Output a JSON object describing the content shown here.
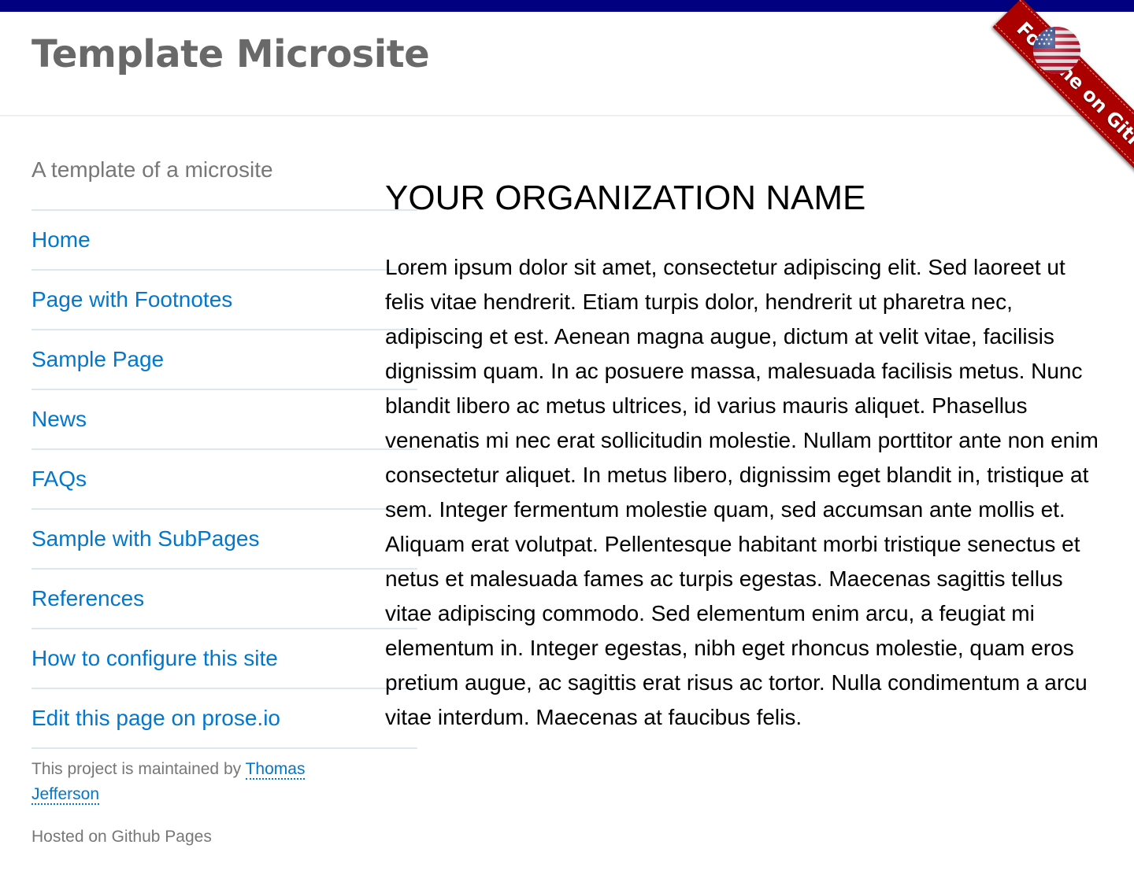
{
  "header": {
    "title": "Template Microsite",
    "ribbon_label": "Fork me on GitHub",
    "flag_icon": "us-flag-icon"
  },
  "sidebar": {
    "tagline": "A template of a microsite",
    "nav": [
      {
        "label": "Home"
      },
      {
        "label": "Page with Footnotes"
      },
      {
        "label": "Sample Page"
      },
      {
        "label": "News"
      },
      {
        "label": "FAQs"
      },
      {
        "label": "Sample with SubPages"
      },
      {
        "label": "References"
      },
      {
        "label": "How to configure this site"
      },
      {
        "label": "Edit this page on prose.io"
      }
    ],
    "maintainer_prefix": "This project is maintained by",
    "maintainer_name": "Thomas Jefferson",
    "hosted_text": "Hosted on Github Pages"
  },
  "main": {
    "heading": "YOUR ORGANIZATION NAME",
    "paragraph": "Lorem ipsum dolor sit amet, consectetur adipiscing elit. Sed laoreet ut felis vitae hendrerit. Etiam turpis dolor, hendrerit ut pharetra nec, adipiscing et est. Aenean magna augue, dictum at velit vitae, facilisis dignissim quam. In ac posuere massa, malesuada facilisis metus. Nunc blandit libero ac metus ultrices, id varius mauris aliquet. Phasellus venenatis mi nec erat sollicitudin molestie. Nullam porttitor ante non enim consectetur aliquet. In metus libero, dignissim eget blandit in, tristique at sem. Integer fermentum molestie quam, sed accumsan ante mollis et. Aliquam erat volutpat. Pellentesque habitant morbi tristique senectus et netus et malesuada fames ac turpis egestas. Maecenas sagittis tellus vitae adipiscing commodo. Sed elementum enim arcu, a feugiat mi elementum in. Integer egestas, nibh eget rhoncus molestie, quam eros pretium augue, ac sagittis erat risus ac tortor. Nulla condimentum a arcu vitae interdum. Maecenas at faucibus felis."
  },
  "colors": {
    "top_bar": "#000080",
    "link": "#0277cc",
    "ribbon": "#aa0000",
    "title_gray": "#696969",
    "muted_gray": "#777777",
    "rule": "#dbe7f1"
  }
}
